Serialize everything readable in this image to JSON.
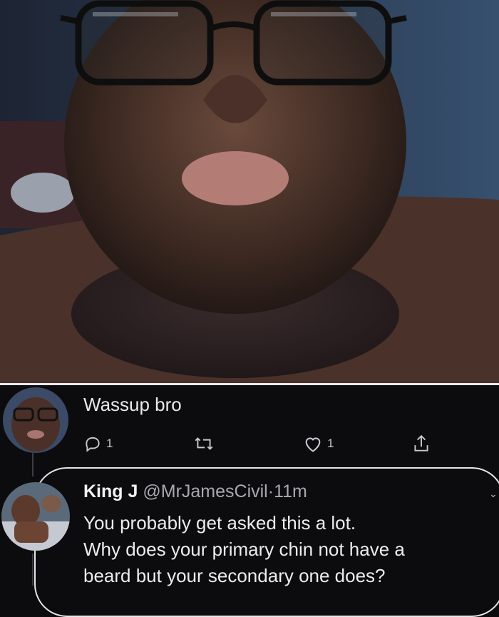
{
  "tweet": {
    "text": "Wassup bro",
    "reply_count": "1",
    "retweet_count": "",
    "like_count": "1"
  },
  "reply": {
    "name": "King J",
    "handle": "@MrJamesCivil",
    "separator": "·",
    "time": "11m",
    "lines": [
      "You probably get asked this a lot.",
      "Why does your primary chin not have a",
      "beard but your secondary one does?"
    ]
  },
  "icons": {
    "reply": "reply-icon",
    "retweet": "retweet-icon",
    "like": "heart-icon",
    "share": "share-icon"
  },
  "colors": {
    "background": "#0c0c0e",
    "text": "#e8e8ea",
    "muted": "#a8a9af",
    "bubble_outline": "#e6e6e6"
  }
}
